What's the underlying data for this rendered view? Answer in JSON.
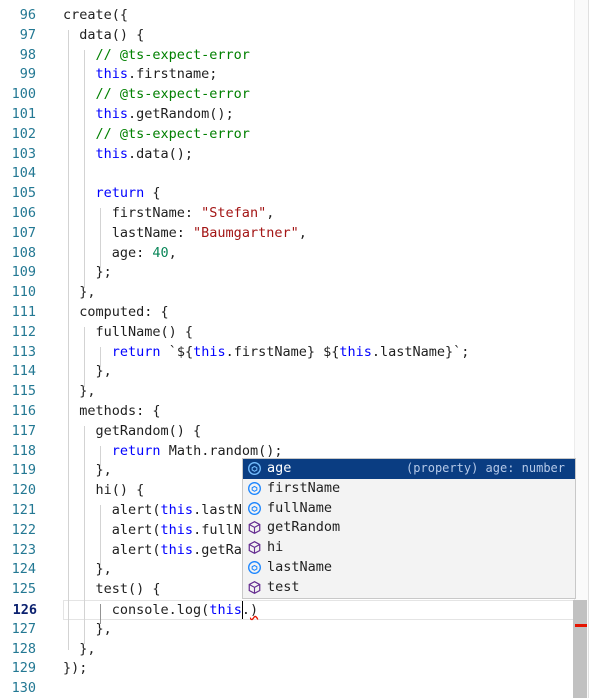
{
  "editor": {
    "lines": [
      {
        "n": "96",
        "code": [
          {
            "t": "create({",
            "c": ""
          }
        ]
      },
      {
        "n": "97",
        "code": [
          {
            "t": "  data() {",
            "c": ""
          }
        ]
      },
      {
        "n": "98",
        "code": [
          {
            "t": "    // @ts-expect-error",
            "c": "cm"
          }
        ]
      },
      {
        "n": "99",
        "code": [
          {
            "t": "    ",
            "c": ""
          },
          {
            "t": "this",
            "c": "kw"
          },
          {
            "t": ".firstname;",
            "c": ""
          }
        ]
      },
      {
        "n": "100",
        "code": [
          {
            "t": "    // @ts-expect-error",
            "c": "cm"
          }
        ]
      },
      {
        "n": "101",
        "code": [
          {
            "t": "    ",
            "c": ""
          },
          {
            "t": "this",
            "c": "kw"
          },
          {
            "t": ".getRandom();",
            "c": ""
          }
        ]
      },
      {
        "n": "102",
        "code": [
          {
            "t": "    // @ts-expect-error",
            "c": "cm"
          }
        ]
      },
      {
        "n": "103",
        "code": [
          {
            "t": "    ",
            "c": ""
          },
          {
            "t": "this",
            "c": "kw"
          },
          {
            "t": ".data();",
            "c": ""
          }
        ]
      },
      {
        "n": "104",
        "code": []
      },
      {
        "n": "105",
        "code": [
          {
            "t": "    ",
            "c": ""
          },
          {
            "t": "return",
            "c": "kw"
          },
          {
            "t": " {",
            "c": ""
          }
        ]
      },
      {
        "n": "106",
        "code": [
          {
            "t": "      firstName: ",
            "c": ""
          },
          {
            "t": "\"Stefan\"",
            "c": "str"
          },
          {
            "t": ",",
            "c": ""
          }
        ]
      },
      {
        "n": "107",
        "code": [
          {
            "t": "      lastName: ",
            "c": ""
          },
          {
            "t": "\"Baumgartner\"",
            "c": "str"
          },
          {
            "t": ",",
            "c": ""
          }
        ]
      },
      {
        "n": "108",
        "code": [
          {
            "t": "      age: ",
            "c": ""
          },
          {
            "t": "40",
            "c": "num"
          },
          {
            "t": ",",
            "c": ""
          }
        ]
      },
      {
        "n": "109",
        "code": [
          {
            "t": "    };",
            "c": ""
          }
        ]
      },
      {
        "n": "110",
        "code": [
          {
            "t": "  },",
            "c": ""
          }
        ]
      },
      {
        "n": "111",
        "code": [
          {
            "t": "  computed: {",
            "c": ""
          }
        ]
      },
      {
        "n": "112",
        "code": [
          {
            "t": "    fullName() {",
            "c": ""
          }
        ]
      },
      {
        "n": "113",
        "code": [
          {
            "t": "      ",
            "c": ""
          },
          {
            "t": "return",
            "c": "kw"
          },
          {
            "t": " `${",
            "c": ""
          },
          {
            "t": "this",
            "c": "kw"
          },
          {
            "t": ".firstName} ${",
            "c": ""
          },
          {
            "t": "this",
            "c": "kw"
          },
          {
            "t": ".lastName}`;",
            "c": ""
          }
        ]
      },
      {
        "n": "114",
        "code": [
          {
            "t": "    },",
            "c": ""
          }
        ]
      },
      {
        "n": "115",
        "code": [
          {
            "t": "  },",
            "c": ""
          }
        ]
      },
      {
        "n": "116",
        "code": [
          {
            "t": "  methods: {",
            "c": ""
          }
        ]
      },
      {
        "n": "117",
        "code": [
          {
            "t": "    getRandom() {",
            "c": ""
          }
        ]
      },
      {
        "n": "118",
        "code": [
          {
            "t": "      ",
            "c": ""
          },
          {
            "t": "return",
            "c": "kw"
          },
          {
            "t": " Math.random();",
            "c": ""
          }
        ]
      },
      {
        "n": "119",
        "code": [
          {
            "t": "    },",
            "c": ""
          }
        ]
      },
      {
        "n": "120",
        "code": [
          {
            "t": "    hi() {",
            "c": ""
          }
        ]
      },
      {
        "n": "121",
        "code": [
          {
            "t": "      alert(",
            "c": ""
          },
          {
            "t": "this",
            "c": "kw"
          },
          {
            "t": ".lastNa",
            "c": ""
          }
        ]
      },
      {
        "n": "122",
        "code": [
          {
            "t": "      alert(",
            "c": ""
          },
          {
            "t": "this",
            "c": "kw"
          },
          {
            "t": ".fullNa",
            "c": ""
          }
        ]
      },
      {
        "n": "123",
        "code": [
          {
            "t": "      alert(",
            "c": ""
          },
          {
            "t": "this",
            "c": "kw"
          },
          {
            "t": ".getRan",
            "c": ""
          }
        ]
      },
      {
        "n": "124",
        "code": [
          {
            "t": "    },",
            "c": ""
          }
        ]
      },
      {
        "n": "125",
        "code": [
          {
            "t": "    test() {",
            "c": ""
          }
        ]
      },
      {
        "n": "126",
        "code": [
          {
            "t": "      console.log(",
            "c": ""
          },
          {
            "t": "this",
            "c": "kw"
          },
          {
            "t": ".",
            "c": ""
          },
          {
            "t": ")",
            "c": "squiggle"
          }
        ],
        "current": true
      },
      {
        "n": "127",
        "code": [
          {
            "t": "    },",
            "c": ""
          }
        ]
      },
      {
        "n": "128",
        "code": [
          {
            "t": "  },",
            "c": ""
          }
        ]
      },
      {
        "n": "129",
        "code": [
          {
            "t": "});",
            "c": ""
          }
        ]
      },
      {
        "n": "130",
        "code": []
      }
    ]
  },
  "suggest": {
    "items": [
      {
        "label": "age",
        "detail": "(property) age: number",
        "icon": "property-icon",
        "selected": true
      },
      {
        "label": "firstName",
        "icon": "property-icon"
      },
      {
        "label": "fullName",
        "icon": "property-icon"
      },
      {
        "label": "getRandom",
        "icon": "method-cube-icon"
      },
      {
        "label": "hi",
        "icon": "method-cube-icon"
      },
      {
        "label": "lastName",
        "icon": "property-icon"
      },
      {
        "label": "test",
        "icon": "method-cube-icon"
      }
    ]
  },
  "colors": {
    "keyword": "#0000ff",
    "comment": "#008000",
    "string": "#a31515",
    "number": "#098658",
    "lineNumber": "#237893",
    "selection": "#0a3d82",
    "error": "#e51400"
  }
}
